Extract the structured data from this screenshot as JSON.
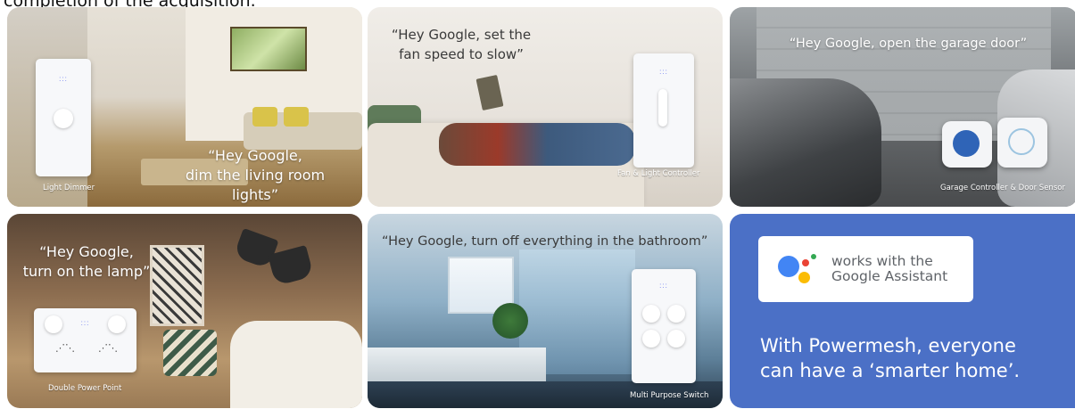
{
  "header": {
    "cut_off_text": "completion of the acquisition."
  },
  "tiles": [
    {
      "quote": "“Hey Google,\ndim the living room lights”",
      "caption": "Light Dimmer"
    },
    {
      "quote": "“Hey Google, set the\nfan speed to slow”",
      "caption": "Fan & Light Controller"
    },
    {
      "quote": "“Hey Google, open the garage door”",
      "caption": "Garage Controller & Door Sensor"
    },
    {
      "quote": "“Hey Google,\nturn on the lamp”",
      "caption": "Double Power Point"
    },
    {
      "quote": "“Hey Google, turn off everything in the bathroom”",
      "caption": "Multi Purpose Switch"
    }
  ],
  "google_assistant": {
    "badge_line1": "works with the",
    "badge_line2": "Google Assistant",
    "tagline_line1": "With Powermesh, everyone",
    "tagline_line2": "can have a ‘smarter home’."
  },
  "colors": {
    "assistant_panel": "#4b70c6",
    "google_blue": "#4285F4",
    "google_red": "#EA4335",
    "google_yellow": "#FBBC05",
    "google_green": "#34A853"
  },
  "icons": [
    "google-assistant-logo-icon"
  ]
}
